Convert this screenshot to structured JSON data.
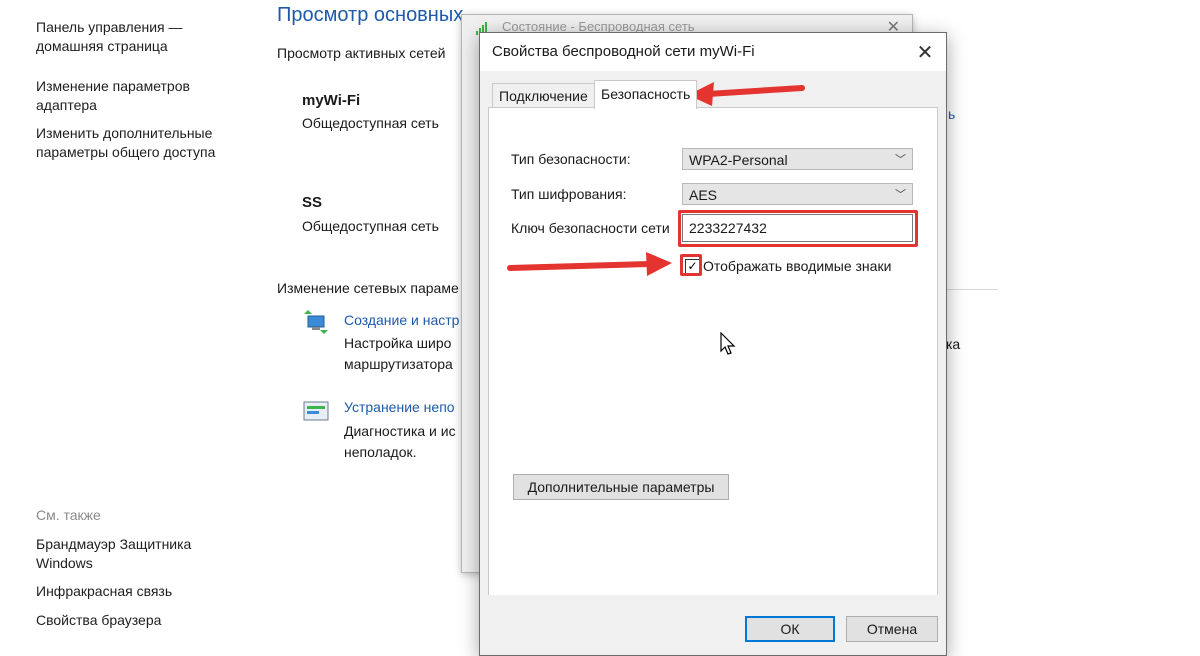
{
  "left_pane": {
    "home_link": "Панель управления — домашняя страница",
    "adapter_link": "Изменение параметров адаптера",
    "sharing_link": "Изменить дополнительные параметры общего доступа",
    "see_also_label": "См. также",
    "see_also": {
      "firewall": "Брандмауэр Защитника Windows",
      "infrared": "Инфракрасная связь",
      "browser": "Свойства браузера"
    }
  },
  "main": {
    "title": "Просмотр основных",
    "active_networks_label": "Просмотр активных сетей",
    "network1": {
      "name": "myWi-Fi",
      "type": "Общедоступная сеть"
    },
    "network2": {
      "name": "SS",
      "type": "Общедоступная сеть"
    },
    "change_settings_label": "Изменение сетевых параме",
    "task1": {
      "link": "Создание и настр",
      "desc": "Настройка широ маршрутизатора"
    },
    "task2": {
      "link": "Устранение непо",
      "desc": "Диагностика и ис неполадок."
    },
    "edge_text_1": "ь",
    "edge_text_2": "ка"
  },
  "status_window": {
    "title": "Состояние - Беспроводная сеть"
  },
  "dialog": {
    "title": "Свойства беспроводной сети myWi-Fi",
    "tabs": {
      "connection": "Подключение",
      "security": "Безопасность"
    },
    "security_type_label": "Тип безопасности:",
    "security_type_value": "WPA2-Personal",
    "encryption_type_label": "Тип шифрования:",
    "encryption_type_value": "AES",
    "key_label": "Ключ безопасности сети",
    "key_value": "2233227432",
    "show_chars_label": "Отображать вводимые знаки",
    "show_chars_checked": "✓",
    "advanced_button": "Дополнительные параметры",
    "ok_button": "ОК",
    "cancel_button": "Отмена"
  },
  "colors": {
    "link_blue": "#1e5aa8",
    "annotation_red": "#e3342f",
    "accent_blue": "#0078d7"
  }
}
